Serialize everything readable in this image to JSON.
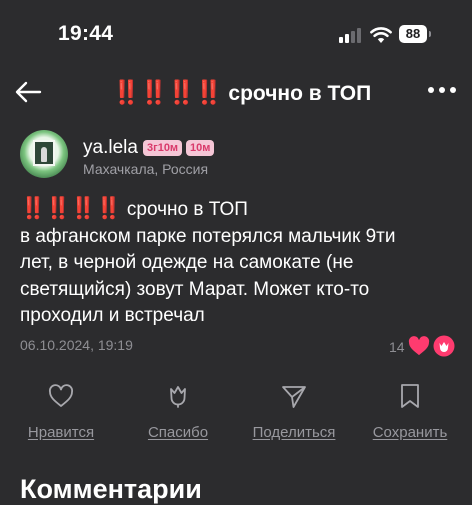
{
  "status_bar": {
    "time": "19:44",
    "battery": "88"
  },
  "header": {
    "marks": "‼️‼️‼️‼️",
    "title": "срочно в ТОП",
    "back_icon": "arrow-left-icon",
    "more_icon": "more-dots-icon"
  },
  "author": {
    "username": "ya.lela",
    "badges": [
      "3г10м",
      "10м"
    ],
    "location": "Махачкала, Россия"
  },
  "post": {
    "marks": "‼️‼️‼️‼️",
    "title": "срочно в ТОП",
    "lines": [
      "в афганском парке потерялся мальчик 9ти",
      "лет, в черной одежде на самокате (не",
      "светящийся) зовут Марат. Может кто-то",
      "проходил и встречал"
    ],
    "date": "06.10.2024, 19:19",
    "reactions_count": "14"
  },
  "actions": [
    {
      "label": "Нравится",
      "icon": "heart-outline-icon"
    },
    {
      "label": "Спасибо",
      "icon": "tulip-icon"
    },
    {
      "label": "Поделиться",
      "icon": "send-icon"
    },
    {
      "label": "Сохранить",
      "icon": "bookmark-icon"
    }
  ],
  "comments": {
    "title": "Комментарии"
  },
  "colors": {
    "background": "#2c2c2e",
    "accent_pink": "#ff3b6f",
    "marks_red": "#e3212b",
    "badge_bg": "#f5c6d6"
  }
}
